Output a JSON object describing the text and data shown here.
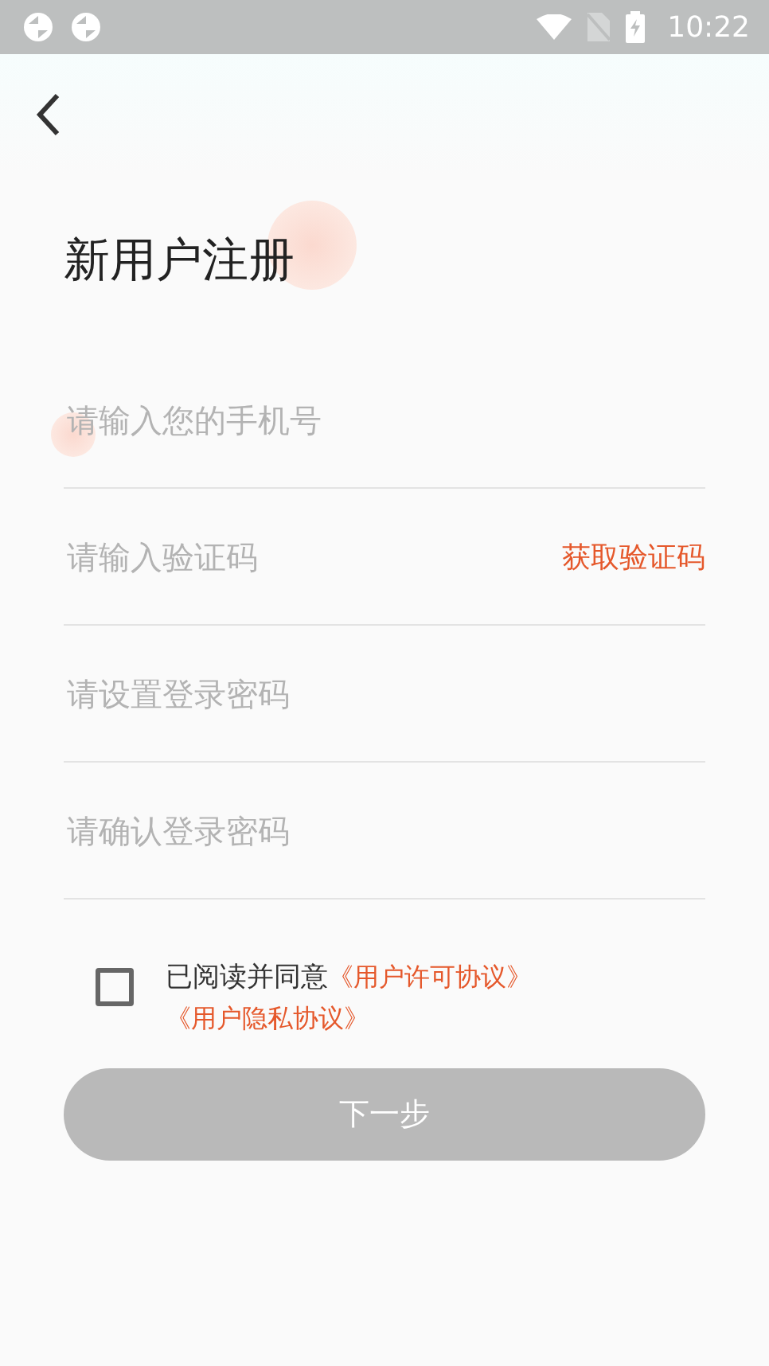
{
  "status_bar": {
    "time": "10:22"
  },
  "title": "新用户注册",
  "fields": [
    {
      "kind": "text",
      "placeholder": "请输入您的手机号"
    },
    {
      "kind": "code",
      "placeholder": "请输入验证码",
      "action": "获取验证码"
    },
    {
      "kind": "text",
      "placeholder": "请设置登录密码"
    },
    {
      "kind": "text",
      "placeholder": "请确认登录密码"
    }
  ],
  "agreement": {
    "checked": false,
    "text": "已阅读并同意",
    "links": [
      "《用户许可协议》",
      "《用户隐私协议》"
    ]
  },
  "next_button": {
    "label": "下一步",
    "disabled": true
  }
}
